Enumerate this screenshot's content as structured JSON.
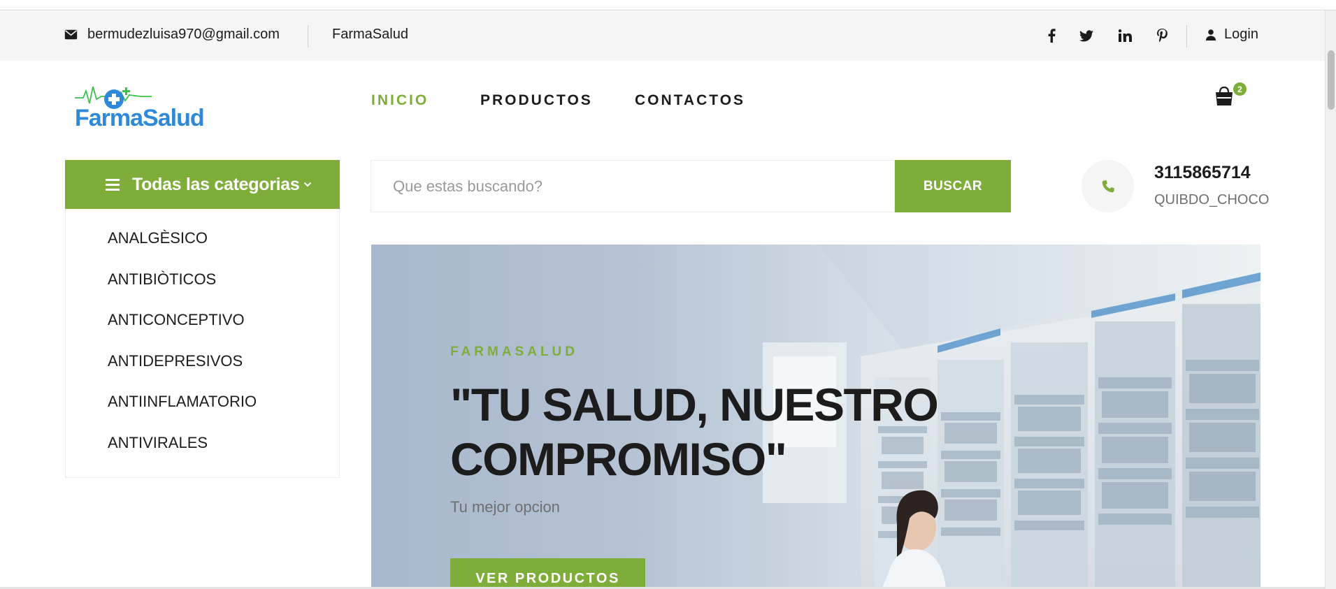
{
  "topbar": {
    "email": "bermudezluisa970@gmail.com",
    "brand": "FarmaSalud",
    "social": [
      "facebook-icon",
      "twitter-icon",
      "linkedin-icon",
      "pinterest-icon"
    ],
    "login_label": "Login"
  },
  "logo": {
    "text": "FarmaSalud"
  },
  "nav": {
    "items": [
      {
        "label": "INICIO",
        "active": true
      },
      {
        "label": "PRODUCTOS",
        "active": false
      },
      {
        "label": "CONTACTOS",
        "active": false
      }
    ]
  },
  "cart": {
    "count": "2"
  },
  "categories": {
    "title": "Todas las categorias",
    "items": [
      "ANALGÈSICO",
      "ANTIBIÒTICOS",
      "ANTICONCEPTIVO",
      "ANTIDEPRESIVOS",
      "ANTIINFLAMATORIO",
      "ANTIVIRALES"
    ]
  },
  "search": {
    "placeholder": "Que estas buscando?",
    "value": "",
    "button_label": "BUSCAR"
  },
  "contact": {
    "phone": "3115865714",
    "city": "QUIBDO_CHOCO"
  },
  "hero": {
    "eyebrow": "FARMASALUD",
    "headline": "\"TU SALUD, NUESTRO COMPROMISO\"",
    "subtitle": "Tu mejor opcion",
    "cta_label": "VER PRODUCTOS"
  },
  "colors": {
    "accent": "#7fad39",
    "text": "#1c1c1c",
    "muted": "#6f6f6f",
    "topbar_bg": "#f5f5f5",
    "logo_blue": "#2e8ad8"
  }
}
